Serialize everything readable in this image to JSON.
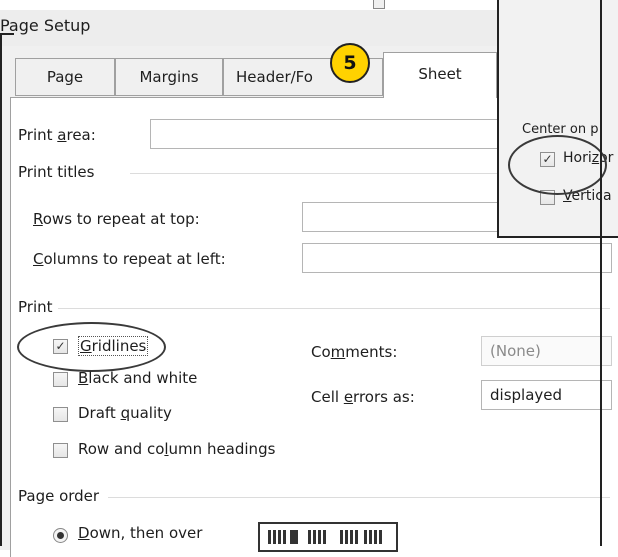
{
  "dialog": {
    "title": "Page Setup"
  },
  "tabs": [
    {
      "label": "Page",
      "active": false
    },
    {
      "label": "Margins",
      "active": false
    },
    {
      "label": "Header/Fo",
      "active": false
    },
    {
      "label": "Sheet",
      "active": true
    }
  ],
  "step_badge": "5",
  "print_area": {
    "label_pre": "Print ",
    "label_u": "a",
    "label_post": "rea:",
    "value": ""
  },
  "print_titles": {
    "heading": "Print titles",
    "rows": {
      "label_u": "R",
      "label_post": "ows to repeat at top:",
      "value": ""
    },
    "cols": {
      "label_u": "C",
      "label_post": "olumns to repeat at left:",
      "value": ""
    }
  },
  "print_group": {
    "heading": "Print",
    "gridlines": {
      "label_u": "G",
      "label_post": "ridlines",
      "checked": true
    },
    "black_white": {
      "label_u": "B",
      "label_post": "lack and white",
      "checked": false
    },
    "draft": {
      "label_pre": "Draft ",
      "label_u": "q",
      "label_post": "uality",
      "checked": false
    },
    "headings": {
      "label_pre": "Row and co",
      "label_u": "l",
      "label_post": "umn headings",
      "checked": false
    },
    "comments": {
      "label_pre": "Co",
      "label_u": "m",
      "label_post": "ments:",
      "value": "(None)"
    },
    "cell_errors": {
      "label_pre": "Cell ",
      "label_u": "e",
      "label_post": "rrors as:",
      "value": "displayed"
    }
  },
  "page_order": {
    "heading": "Page order",
    "down_then_over": {
      "label_u": "D",
      "label_post": "own, then over",
      "selected": true
    }
  },
  "bg_margins": {
    "center_label": "Center on p",
    "horizontally": {
      "label_pre": "Hori",
      "label_u": "z",
      "label_post": "or",
      "checked": true
    },
    "vertically": {
      "label_u": "V",
      "label_post": "ertica",
      "checked": false
    }
  }
}
